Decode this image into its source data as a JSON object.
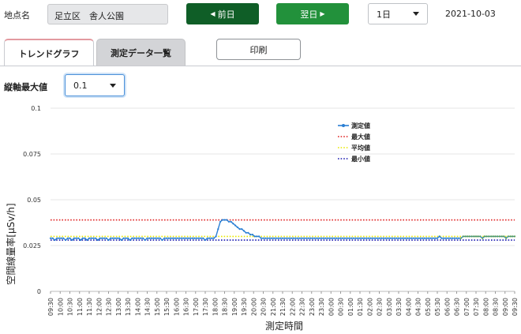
{
  "header": {
    "location_label": "地点名",
    "location_value": "足立区　舎人公園",
    "prev_button": "前日",
    "next_button": "翌日",
    "period_value": "1日",
    "date_value": "2021-10-03"
  },
  "tabs": {
    "trend": "トレンドグラフ",
    "list": "測定データ一覧",
    "print": "印刷"
  },
  "controls": {
    "ymax_label": "縦軸最大値",
    "ymax_value": "0.1"
  },
  "colors": {
    "measured": "#2a7fd4",
    "max": "#e02020",
    "avg": "#e8e800",
    "min": "#1a1ab0",
    "tail": "#5aa050"
  },
  "chart_data": {
    "type": "line",
    "ylabel": "空間線量率[μSv/h]",
    "xlabel": "測定時間",
    "ylim": [
      0,
      0.1
    ],
    "yticks": [
      "0",
      "0.025",
      "0.05",
      "0.075",
      "0.1"
    ],
    "grid": true,
    "legend": [
      {
        "name": "測定値",
        "style": "solid-marker"
      },
      {
        "name": "最大値",
        "style": "dotted"
      },
      {
        "name": "平均値",
        "style": "dotted"
      },
      {
        "name": "最小値",
        "style": "dotted"
      }
    ],
    "legend_position": "top-right",
    "x_labels": [
      "09:30",
      "10:00",
      "10:30",
      "11:00",
      "11:30",
      "12:00",
      "12:30",
      "13:00",
      "13:30",
      "14:00",
      "14:30",
      "15:00",
      "15:30",
      "16:00",
      "16:30",
      "17:00",
      "17:30",
      "18:00",
      "18:30",
      "19:00",
      "19:30",
      "20:00",
      "20:30",
      "21:00",
      "21:30",
      "22:00",
      "22:30",
      "23:00",
      "23:30",
      "00:00",
      "00:30",
      "01:00",
      "01:30",
      "02:00",
      "02:30",
      "03:00",
      "03:30",
      "04:00",
      "04:30",
      "05:00",
      "05:30",
      "06:00",
      "06:30",
      "07:00",
      "07:30",
      "08:00",
      "08:30",
      "09:00",
      "09:30"
    ],
    "max_value": 0.039,
    "avg_value": 0.03,
    "min_value": 0.028,
    "series": [
      {
        "name": "測定値",
        "values": [
          0.029,
          0.029,
          0.028,
          0.029,
          0.029,
          0.029,
          0.029,
          0.028,
          0.029,
          0.029,
          0.028,
          0.029,
          0.029,
          0.029,
          0.028,
          0.029,
          0.029,
          0.028,
          0.029,
          0.029,
          0.029,
          0.029,
          0.028,
          0.029,
          0.029,
          0.029,
          0.029,
          0.028,
          0.029,
          0.029,
          0.029,
          0.029,
          0.029,
          0.028,
          0.029,
          0.029,
          0.029,
          0.028,
          0.029,
          0.029,
          0.029,
          0.029,
          0.029,
          0.029,
          0.028,
          0.029,
          0.029,
          0.029,
          0.029,
          0.029,
          0.029,
          0.029,
          0.028,
          0.029,
          0.029,
          0.029,
          0.029,
          0.029,
          0.029,
          0.029,
          0.029,
          0.029,
          0.029,
          0.029,
          0.029,
          0.029,
          0.029,
          0.029,
          0.029,
          0.029,
          0.029,
          0.029,
          0.028,
          0.029,
          0.029,
          0.029,
          0.029,
          0.03,
          0.034,
          0.038,
          0.039,
          0.039,
          0.039,
          0.038,
          0.038,
          0.037,
          0.036,
          0.035,
          0.034,
          0.034,
          0.033,
          0.032,
          0.032,
          0.031,
          0.031,
          0.03,
          0.03,
          0.03,
          0.029,
          0.029,
          0.029,
          0.029,
          0.029,
          0.029,
          0.029,
          0.029,
          0.029,
          0.029,
          0.029,
          0.029,
          0.029,
          0.029,
          0.029,
          0.029,
          0.029,
          0.029,
          0.029,
          0.029,
          0.029,
          0.029,
          0.029,
          0.029,
          0.029,
          0.029,
          0.029,
          0.029,
          0.029,
          0.029,
          0.029,
          0.029,
          0.029,
          0.029,
          0.029,
          0.029,
          0.029,
          0.029,
          0.029,
          0.029,
          0.029,
          0.029,
          0.029,
          0.029,
          0.029,
          0.029,
          0.029,
          0.029,
          0.029,
          0.029,
          0.029,
          0.029,
          0.029,
          0.029,
          0.029,
          0.029,
          0.029,
          0.029,
          0.029,
          0.029,
          0.029,
          0.029,
          0.029,
          0.029,
          0.029,
          0.029,
          0.029,
          0.029,
          0.029,
          0.029,
          0.029,
          0.029,
          0.029,
          0.029,
          0.029,
          0.029,
          0.029,
          0.029,
          0.029,
          0.029,
          0.029,
          0.029,
          0.029,
          0.03,
          0.029,
          0.029,
          0.029,
          0.029,
          0.029,
          0.029,
          0.029,
          0.029,
          0.029,
          0.029,
          0.03,
          0.03,
          0.03,
          0.03,
          0.03,
          0.03,
          0.03,
          0.03,
          0.03,
          0.029,
          0.03,
          0.03,
          0.03,
          0.03,
          0.03,
          0.03,
          0.03,
          0.03,
          0.03,
          0.03,
          0.029,
          0.03,
          0.03,
          0.03,
          0.03
        ]
      }
    ]
  }
}
